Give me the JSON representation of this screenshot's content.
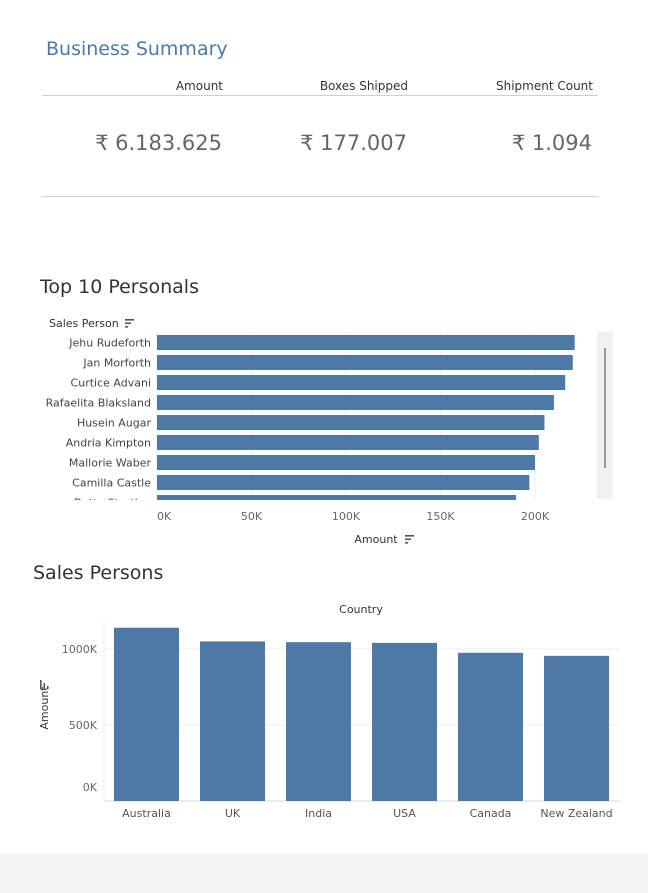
{
  "summary": {
    "title": "Business Summary",
    "kpis": [
      {
        "label": "Amount",
        "value": "₹ 6.183.625"
      },
      {
        "label": "Boxes Shipped",
        "value": "₹ 177.007"
      },
      {
        "label": "Shipment Count",
        "value": "₹ 1.094"
      }
    ]
  },
  "top10": {
    "title": "Top 10 Personals",
    "row_header": "Sales Person",
    "x_label": "Amount"
  },
  "sales": {
    "title": "Sales Persons",
    "col_header": "Country",
    "y_label": "Amount"
  },
  "colors": {
    "bar": "#4e79a7",
    "accent_title": "#4e79a7"
  },
  "chart_data": [
    {
      "type": "bar",
      "orientation": "horizontal",
      "title": "Top 10 Personals",
      "categories": [
        "Jehu Rudeforth",
        "Jan Morforth",
        "Curtice Advani",
        "Rafaelita Blaksland",
        "Husein Augar",
        "Andria Kimpton",
        "Mallorie Waber",
        "Camilla Castle",
        "Dotty Strutley"
      ],
      "values": [
        221000,
        220000,
        216000,
        210000,
        205000,
        202000,
        200000,
        197000,
        190000
      ],
      "xlabel": "Amount",
      "ylabel": "Sales Person",
      "xlim": [
        0,
        240000
      ],
      "xticks": [
        "0K",
        "50K",
        "100K",
        "150K",
        "200K"
      ],
      "grid": true
    },
    {
      "type": "bar",
      "title": "Sales Persons",
      "categories": [
        "Australia",
        "UK",
        "India",
        "USA",
        "Canada",
        "New Zealand"
      ],
      "values": [
        1140000,
        1050000,
        1045000,
        1040000,
        975000,
        955000
      ],
      "xlabel": "Country",
      "ylabel": "Amount",
      "ylim": [
        0,
        1200000
      ],
      "yticks": [
        "0K",
        "500K",
        "1000K"
      ],
      "grid": true
    }
  ]
}
